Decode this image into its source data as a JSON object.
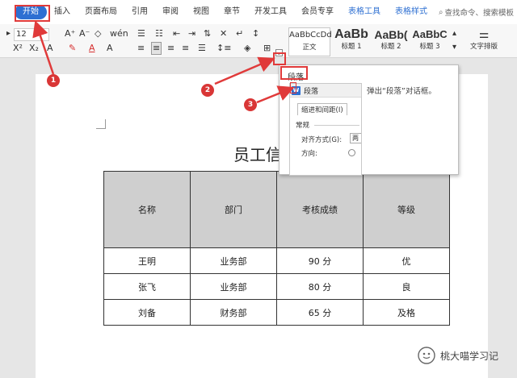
{
  "tabs": [
    {
      "label": "开始",
      "active": true
    },
    {
      "label": "插入"
    },
    {
      "label": "页面布局"
    },
    {
      "label": "引用"
    },
    {
      "label": "审阅"
    },
    {
      "label": "视图"
    },
    {
      "label": "章节"
    },
    {
      "label": "开发工具"
    },
    {
      "label": "会员专享"
    },
    {
      "label": "表格工具",
      "contextual": true
    },
    {
      "label": "表格样式",
      "contextual": true
    }
  ],
  "search": {
    "text": "查找命令、搜索模板"
  },
  "ribbon": {
    "font_size": "12",
    "styles": [
      {
        "sample": "AaBbCcDd",
        "label": "正文"
      },
      {
        "sample": "AaBb",
        "label": "标题 1"
      },
      {
        "sample": "AaBb(",
        "label": "标题 2"
      },
      {
        "sample": "AaBbC",
        "label": "标题 3"
      }
    ],
    "text_layout_label": "文字排版"
  },
  "popup": {
    "title": "段落",
    "description": "弹出“段落”对话框。",
    "dialog": {
      "name": "段落",
      "tab": "缩进和间距(I)",
      "section": "常规",
      "alignment_label": "对齐方式(G):",
      "alignment_value": "两",
      "direction_label": "方向:"
    }
  },
  "document": {
    "title": "员工信",
    "table": {
      "headers": [
        "名称",
        "部门",
        "考核成绩",
        "等级"
      ],
      "rows": [
        [
          "王明",
          "业务部",
          "90 分",
          "优"
        ],
        [
          "张飞",
          "业务部",
          "80 分",
          "良"
        ],
        [
          "刘备",
          "财务部",
          "65 分",
          "及格"
        ]
      ]
    }
  },
  "badges": [
    "1",
    "2",
    "3"
  ],
  "watermark": {
    "text": "桃大喵学习记"
  },
  "colors": {
    "accent": "#2d6fd2",
    "highlight": "#e03a3a",
    "header_fill": "#cfcfcf"
  }
}
